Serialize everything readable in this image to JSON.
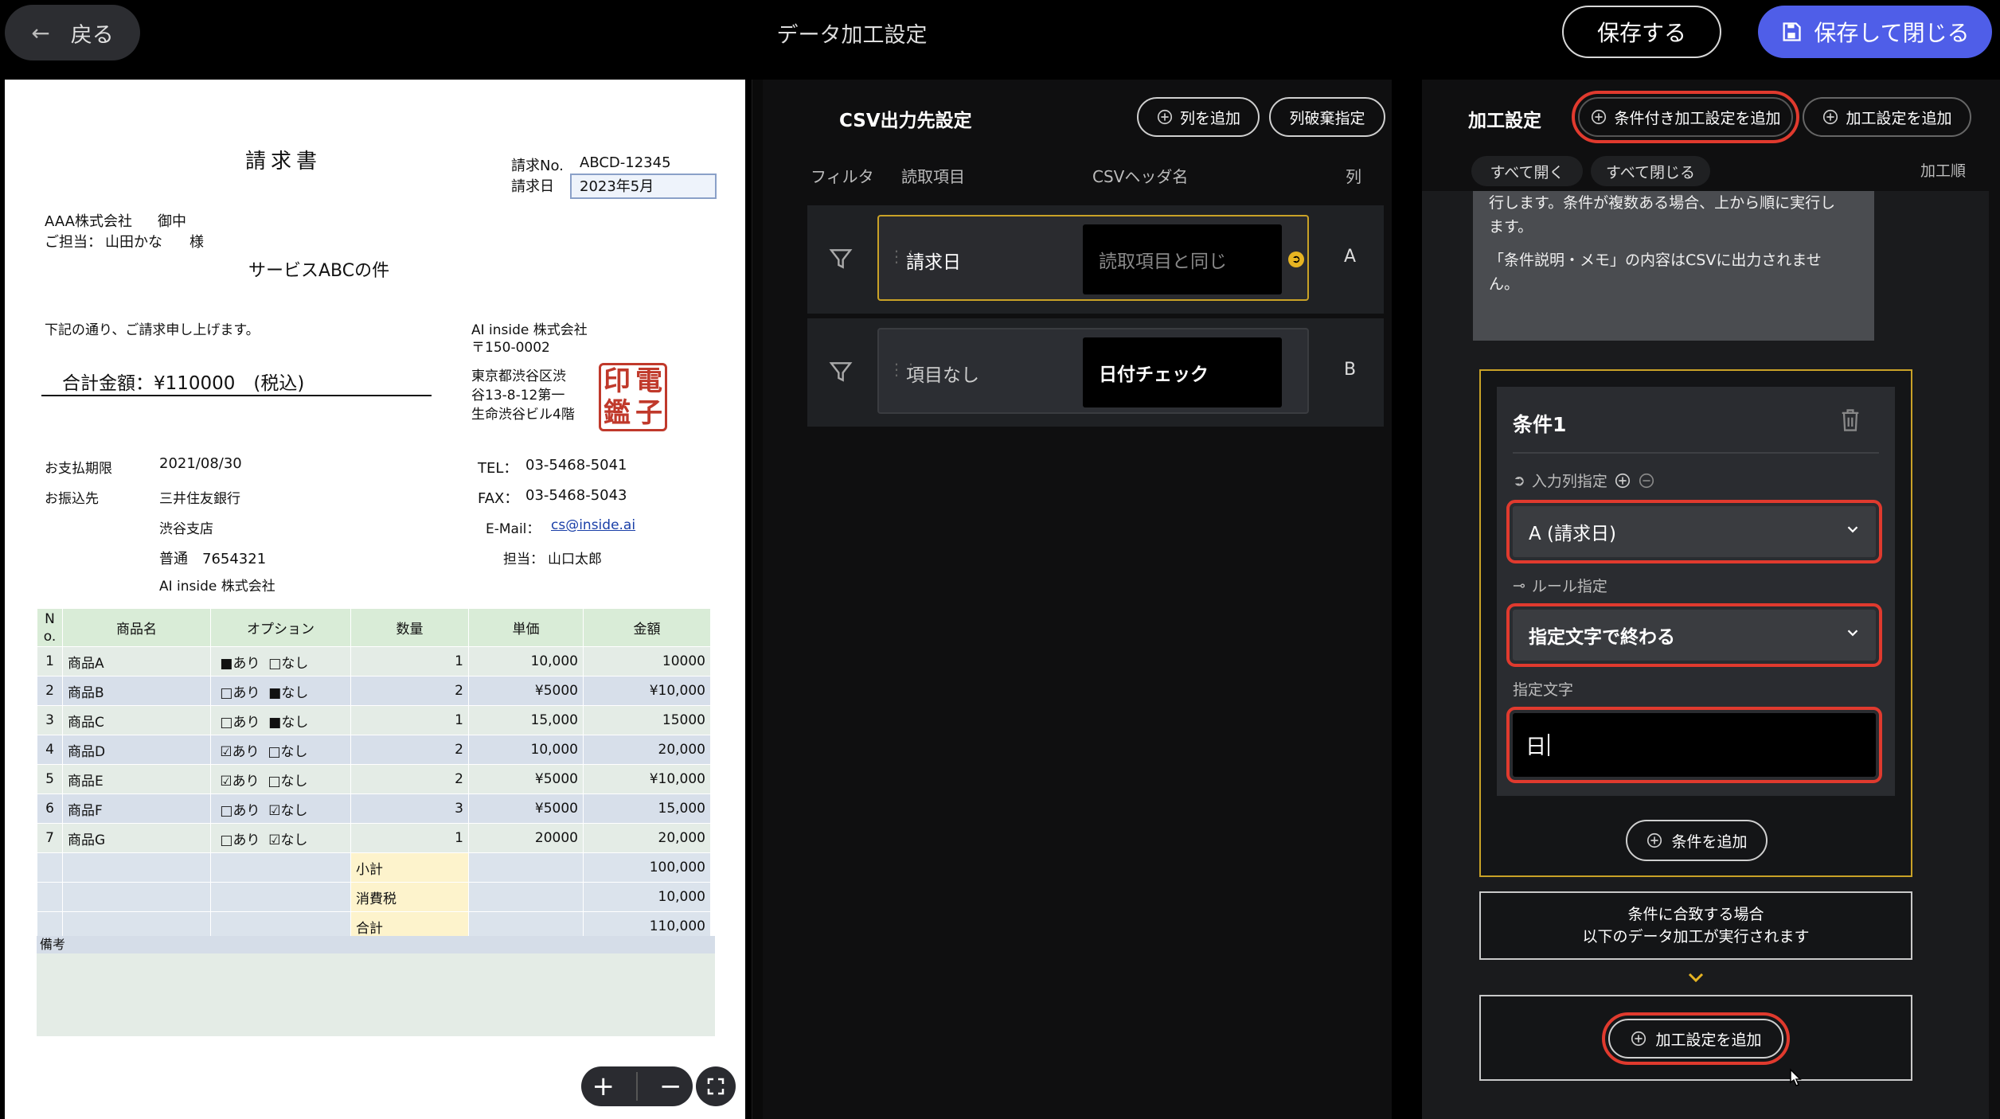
{
  "topbar": {
    "back_label": "戻る",
    "title": "データ加工設定",
    "save_label": "保存する",
    "save_close_label": "保存して閉じる",
    "accent_color": "#4f5ee8"
  },
  "invoice": {
    "title": "請求書",
    "no_label": "請求No.",
    "no_value": "ABCD-12345",
    "date_label": "請求日",
    "date_value": "2023年5月",
    "client": "AAA株式会社",
    "honorific": "御中",
    "contact_label": "ご担当：",
    "contact_name": "山田かな",
    "contact_honorific": "様",
    "subject": "サービスABCの件",
    "intro": "下記の通り、ご請求申し上げます。",
    "total": "合計金額：¥110000　(税込)",
    "company_name": "AI inside 株式会社",
    "postal": "〒150-0002",
    "address1": "東京都渋谷区渋",
    "address2": "谷13-8-12第一",
    "address3": "生命渋谷ビル4階",
    "stamp_chars": [
      "印",
      "電",
      "鑑",
      "子"
    ],
    "due_label": "お支払期限",
    "due_value": "2021/08/30",
    "bank_label": "お振込先",
    "bank": "三井住友銀行",
    "branch": "渋谷支店",
    "account": "普通　7654321",
    "account_holder": "AI inside 株式会社",
    "tel_label": "TEL：",
    "tel": "03-5468-5041",
    "fax_label": "FAX：",
    "fax": "03-5468-5043",
    "email_label": "E-Mail：",
    "email": "cs@inside.ai",
    "rep_label": "担当：",
    "rep": "山口太郎",
    "table_headers": [
      "N\no.",
      "商品名",
      "オプション",
      "数量",
      "単価",
      "金額"
    ],
    "rows": [
      {
        "no": "1",
        "name": "商品A",
        "opt1": "■あり",
        "opt2": "□なし",
        "qty": "1",
        "price": "10,000",
        "amount": "10000"
      },
      {
        "no": "2",
        "name": "商品B",
        "opt1": "□あり",
        "opt2": "■なし",
        "qty": "2",
        "price": "¥5000",
        "amount": "¥10,000"
      },
      {
        "no": "3",
        "name": "商品C",
        "opt1": "□あり",
        "opt2": "■なし",
        "qty": "1",
        "price": "15,000",
        "amount": "15000"
      },
      {
        "no": "4",
        "name": "商品D",
        "opt1": "☑あり",
        "opt2": "□なし",
        "qty": "2",
        "price": "10,000",
        "amount": "20,000"
      },
      {
        "no": "5",
        "name": "商品E",
        "opt1": "☑あり",
        "opt2": "□なし",
        "qty": "2",
        "price": "¥5000",
        "amount": "¥10,000"
      },
      {
        "no": "6",
        "name": "商品F",
        "opt1": "□あり",
        "opt2": "☑なし",
        "qty": "3",
        "price": "¥5000",
        "amount": "15,000"
      },
      {
        "no": "7",
        "name": "商品G",
        "opt1": "□あり",
        "opt2": "☑なし",
        "qty": "1",
        "price": "20000",
        "amount": "20,000"
      }
    ],
    "subtotal_label": "小計",
    "subtotal": "100,000",
    "tax_label": "消費税",
    "tax": "10,000",
    "grand_label": "合計",
    "grand": "110,000",
    "remarks_label": "備考"
  },
  "viewer_controls": {
    "zoom_in": "+",
    "zoom_out": "−"
  },
  "csv": {
    "title": "CSV出力先設定",
    "add_column": "列を追加",
    "discard_column": "列破棄指定",
    "headers": {
      "filter": "フィルタ",
      "read_item": "読取項目",
      "csv_header": "CSVヘッダ名",
      "column": "列"
    },
    "rows": [
      {
        "label": "請求日",
        "header": "読取項目と同じ",
        "column": "A"
      },
      {
        "label": "項目なし",
        "header": "日付チェック",
        "column": "B"
      }
    ]
  },
  "processing": {
    "title": "加工設定",
    "add_conditional": "条件付き加工設定を追加",
    "add_processing": "加工設定を追加",
    "expand_all": "すべて開く",
    "collapse_all": "すべて閉じる",
    "order_label": "加工順",
    "info_line1": "行します。条件が複数ある場合、上から順に実行し",
    "info_line2": "ます。",
    "info_line3": "「条件説明・メモ」の内容はCSVに出力されませ",
    "info_line4": "ん。",
    "condition_title": "条件1",
    "input_col_label": "入力列指定",
    "input_col_value": "A (請求日)",
    "rule_label": "ルール指定",
    "rule_value": "指定文字で終わる",
    "text_label": "指定文字",
    "text_value": "日",
    "add_condition": "条件を追加",
    "match_line1": "条件に合致する場合",
    "match_line2": "以下のデータ加工が実行されます",
    "add_processing_bottom": "加工設定を追加",
    "highlight_color": "#e03a2e",
    "active_border_color": "#c9a227"
  }
}
